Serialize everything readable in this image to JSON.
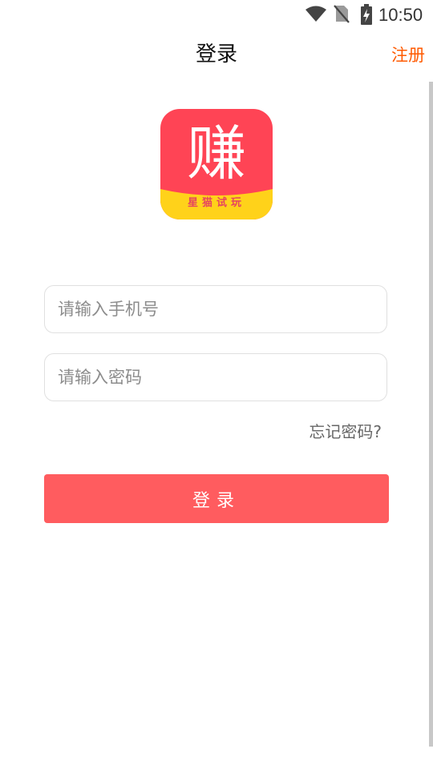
{
  "status_bar": {
    "time": "10:50",
    "icons": [
      "wifi-icon",
      "no-sim-icon",
      "battery-charging-icon"
    ]
  },
  "header": {
    "title": "登录",
    "register_label": "注册"
  },
  "logo": {
    "main_char": "赚",
    "subtitle": "星猫试玩"
  },
  "form": {
    "phone_placeholder": "请输入手机号",
    "password_placeholder": "请输入密码",
    "forgot_label": "忘记密码?",
    "login_label": "登录"
  },
  "colors": {
    "accent": "#ff5c5f",
    "register": "#ff5a00",
    "logo_red": "#ff4455",
    "logo_yellow": "#ffd21a"
  }
}
